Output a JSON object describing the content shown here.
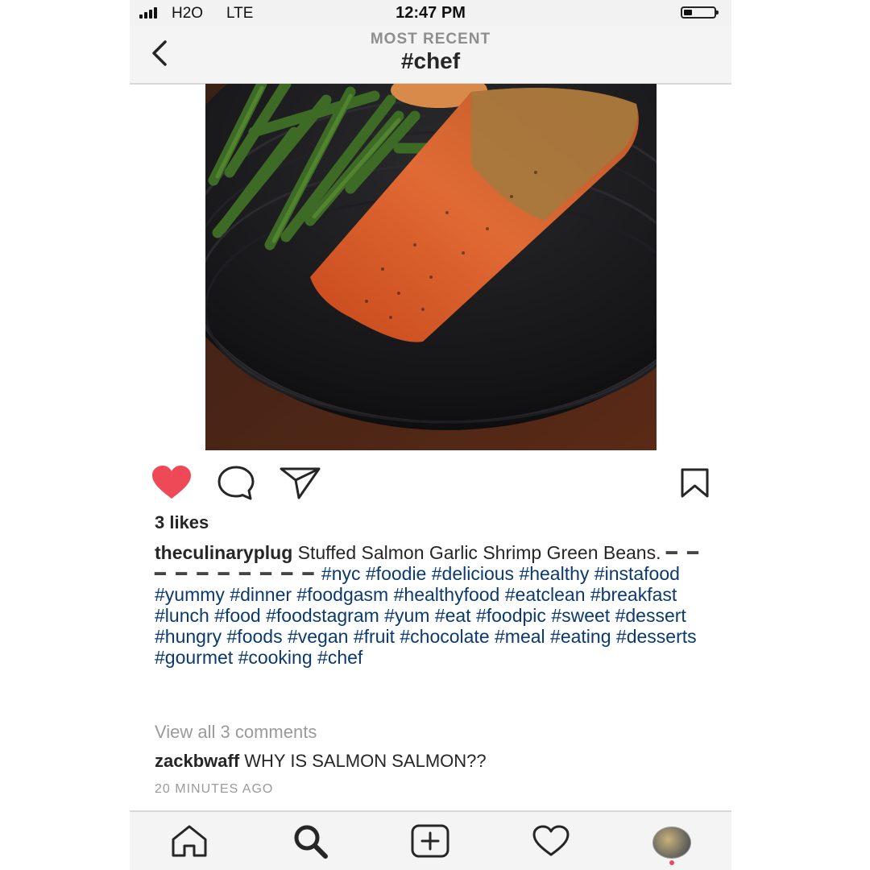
{
  "status_bar": {
    "carrier": "H2O",
    "network": "LTE",
    "time": "12:47 PM"
  },
  "header": {
    "subtitle": "MOST RECENT",
    "title": "#chef",
    "back_icon": "chevron-left-icon"
  },
  "post": {
    "image_icon": "salmon-photo",
    "liked": true,
    "like_color": "#ed4956",
    "likes_text": "3 likes",
    "username": "theculinaryplug",
    "caption_text": "Stuffed Salmon Garlic Shrimp Green Beans.",
    "caption_dashes": "━ ━ ━ ━ ━ ━ ━ ━ ━ ━",
    "hashtags": [
      "#nyc",
      "#foodie",
      "#delicious",
      "#healthy",
      "#instafood",
      "#yummy",
      "#dinner",
      "#foodgasm",
      "#healthyfood",
      "#eatclean",
      "#breakfast",
      "#lunch",
      "#food",
      "#foodstagram",
      "#yum",
      "#eat",
      "#foodpic",
      "#sweet",
      "#dessert",
      "#hungry",
      "#foods",
      "#vegan",
      "#fruit",
      "#chocolate",
      "#meal",
      "#eating",
      "#desserts",
      "#gourmet",
      "#cooking",
      "#chef"
    ],
    "hashtag_color": "#0b3a6e",
    "view_all_comments": "View all 3 comments",
    "comment": {
      "username": "zackbwaff",
      "text": "WHY IS SALMON SALMON??"
    },
    "time_ago": "20 MINUTES AGO"
  },
  "tab_bar": {
    "items": [
      "home-icon",
      "search-icon",
      "add-post-icon",
      "activity-heart-icon",
      "profile-avatar"
    ]
  }
}
